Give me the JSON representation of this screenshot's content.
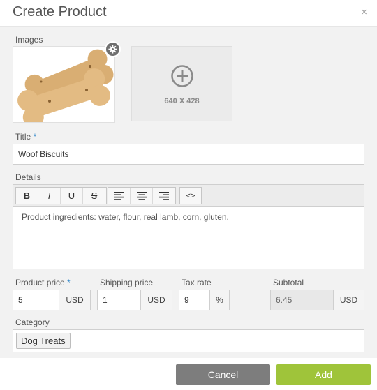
{
  "dialog": {
    "title": "Create Product",
    "close_glyph": "×"
  },
  "images": {
    "label": "Images",
    "image_alt": "dog bone biscuits",
    "settings_icon": "gear-icon",
    "add_icon": "plus-circle-icon",
    "placeholder_dims": "640 X 428"
  },
  "title_field": {
    "label": "Title",
    "required_mark": "*",
    "value": "Woof Biscuits"
  },
  "details": {
    "label": "Details",
    "toolbar": [
      {
        "name": "bold-button",
        "glyph": "B"
      },
      {
        "name": "italic-button",
        "glyph": "I"
      },
      {
        "name": "underline-button",
        "glyph": "U"
      },
      {
        "name": "strikethrough-button",
        "glyph": "S"
      }
    ],
    "align_icons": [
      "align-left-icon",
      "align-center-icon",
      "align-right-icon"
    ],
    "code_glyph": "<>",
    "content": "Product ingredients: water, flour, real lamb, corn, gluten."
  },
  "pricing": {
    "product_price": {
      "label": "Product price",
      "required_mark": "*",
      "value": "5",
      "unit": "USD"
    },
    "shipping_price": {
      "label": "Shipping price",
      "value": "1",
      "unit": "USD"
    },
    "tax_rate": {
      "label": "Tax rate",
      "value": "9",
      "unit": "%"
    },
    "subtotal": {
      "label": "Subtotal",
      "value": "6.45",
      "unit": "USD"
    }
  },
  "category": {
    "label": "Category",
    "tags": [
      "Dog Treats"
    ]
  },
  "footer": {
    "cancel_label": "Cancel",
    "add_label": "Add"
  },
  "colors": {
    "accent": "#9fc43a",
    "cancel": "#7d7d7d",
    "required": "#2f86c9"
  }
}
